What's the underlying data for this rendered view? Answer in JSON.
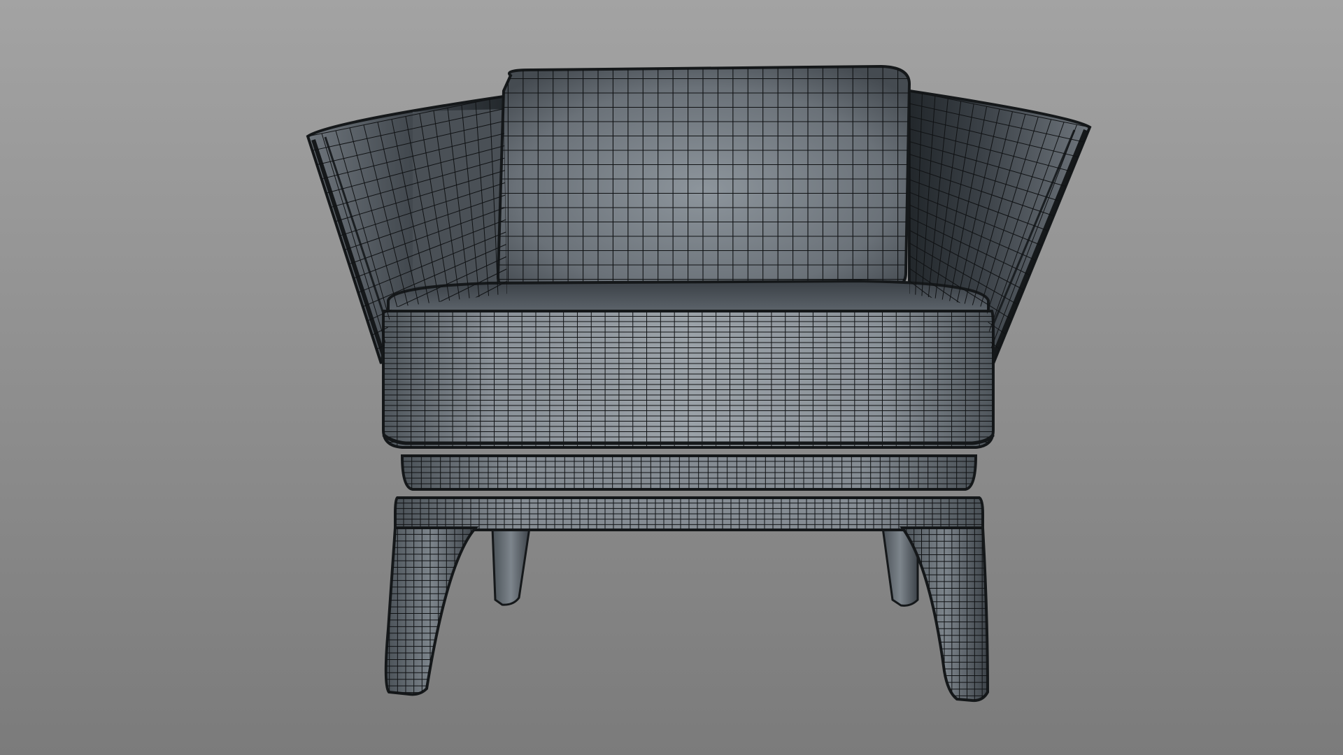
{
  "viewport": {
    "background_top": "#a3a3a3",
    "background_bottom": "#7b7b7b"
  },
  "model": {
    "subject": "armchair",
    "display_mode": "wireframe-on-shaded",
    "colors": {
      "surface_light": "#8c949c",
      "surface_mid": "#5f666e",
      "surface_dark": "#2d3237",
      "wire": "#121416",
      "trim": "#15181a"
    }
  }
}
